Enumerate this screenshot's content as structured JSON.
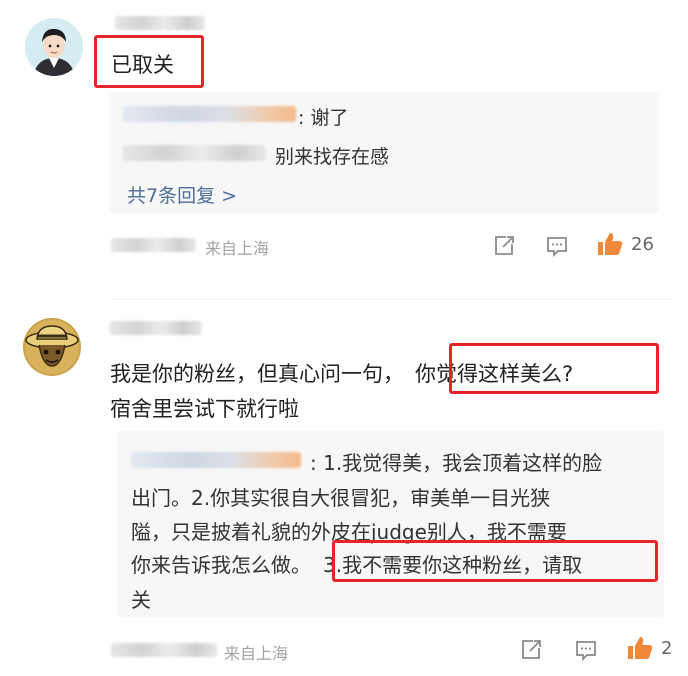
{
  "comments": [
    {
      "avatar": "cartoon-person-avatar",
      "text": "已取关",
      "replies": [
        {
          "prefix": ":",
          "text": "谢了"
        },
        {
          "prefix": "",
          "text": "别来找存在感"
        }
      ],
      "more_replies": "共7条回复 >",
      "location": "来自上海",
      "likes": "26"
    },
    {
      "avatar": "straw-hat-avatar",
      "text_line1_a": "我是你的粉丝，但真心问一句，",
      "text_line1_b": "你觉得这样美么?",
      "text_line2": "宿舍里尝试下就行啦",
      "reply": {
        "line1": ": 1.我觉得美，我会顶着这样的脸",
        "line2": "出门。2.你其实很自大很冒犯，审美单一目光狭",
        "line3": "隘，只是披着礼貌的外皮在judge别人，我不需要",
        "line4_a": "你来告诉我怎么做。",
        "line4_b": "3.我不需要你这种粉丝，请取",
        "line5": "关"
      },
      "location": "来自上海",
      "likes": "2"
    }
  ],
  "colors": {
    "highlight": "#e8232a",
    "like": "#f0883a",
    "link": "#4e6d9a"
  }
}
